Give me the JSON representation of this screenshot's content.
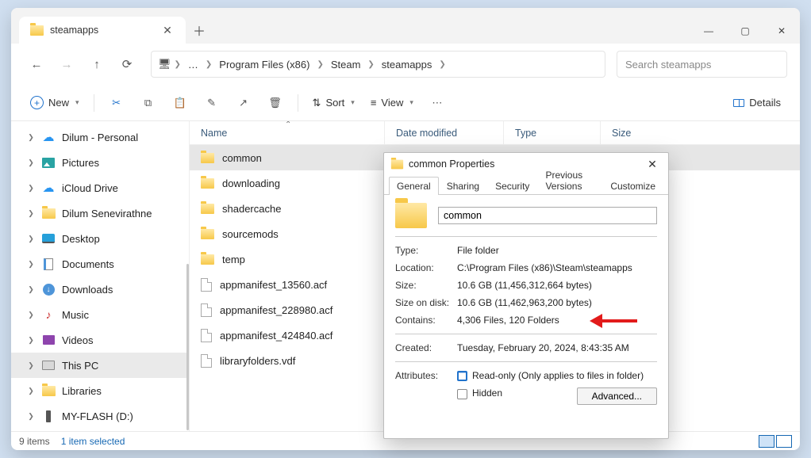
{
  "tab": {
    "title": "steamapps"
  },
  "nav_buttons": {
    "back": "←",
    "forward": "→",
    "up": "↑",
    "refresh": "⟳"
  },
  "breadcrumb": {
    "root_icon": "🖥",
    "overflow": "…",
    "segments": [
      "Program Files (x86)",
      "Steam",
      "steamapps"
    ]
  },
  "search": {
    "placeholder": "Search steamapps"
  },
  "toolbar": {
    "new": "New",
    "sort": "Sort",
    "view": "View",
    "details": "Details"
  },
  "columns": {
    "name": "Name",
    "date": "Date modified",
    "type": "Type",
    "size": "Size"
  },
  "navpane": [
    {
      "label": "Dilum - Personal",
      "icon": "cloud"
    },
    {
      "label": "Pictures",
      "icon": "pic"
    },
    {
      "label": "iCloud Drive",
      "icon": "cloud"
    },
    {
      "label": "Dilum Senevirathne",
      "icon": "folder"
    },
    {
      "label": "Desktop",
      "icon": "desk"
    },
    {
      "label": "Documents",
      "icon": "doc"
    },
    {
      "label": "Downloads",
      "icon": "down"
    },
    {
      "label": "Music",
      "icon": "mus"
    },
    {
      "label": "Videos",
      "icon": "vid"
    },
    {
      "label": "This PC",
      "icon": "pc",
      "selected": true
    },
    {
      "label": "Libraries",
      "icon": "folder"
    },
    {
      "label": "MY-FLASH (D:)",
      "icon": "usb"
    }
  ],
  "files": [
    {
      "name": "common",
      "kind": "folder",
      "selected": true
    },
    {
      "name": "downloading",
      "kind": "folder"
    },
    {
      "name": "shadercache",
      "kind": "folder"
    },
    {
      "name": "sourcemods",
      "kind": "folder"
    },
    {
      "name": "temp",
      "kind": "folder"
    },
    {
      "name": "appmanifest_13560.acf",
      "kind": "file"
    },
    {
      "name": "appmanifest_228980.acf",
      "kind": "file"
    },
    {
      "name": "appmanifest_424840.acf",
      "kind": "file"
    },
    {
      "name": "libraryfolders.vdf",
      "kind": "file"
    }
  ],
  "status": {
    "items": "9 items",
    "selected": "1 item selected"
  },
  "properties": {
    "title": "common Properties",
    "tabs": [
      "General",
      "Sharing",
      "Security",
      "Previous Versions",
      "Customize"
    ],
    "name_value": "common",
    "rows": {
      "type_label": "Type:",
      "type_value": "File folder",
      "location_label": "Location:",
      "location_value": "C:\\Program Files (x86)\\Steam\\steamapps",
      "size_label": "Size:",
      "size_value": "10.6 GB (11,456,312,664 bytes)",
      "sod_label": "Size on disk:",
      "sod_value": "10.6 GB (11,462,963,200 bytes)",
      "contains_label": "Contains:",
      "contains_value": "4,306 Files, 120 Folders",
      "created_label": "Created:",
      "created_value": "Tuesday, February 20, 2024, 8:43:35 AM",
      "attr_label": "Attributes:",
      "readonly_label": "Read-only (Only applies to files in folder)",
      "hidden_label": "Hidden",
      "advanced": "Advanced..."
    }
  }
}
